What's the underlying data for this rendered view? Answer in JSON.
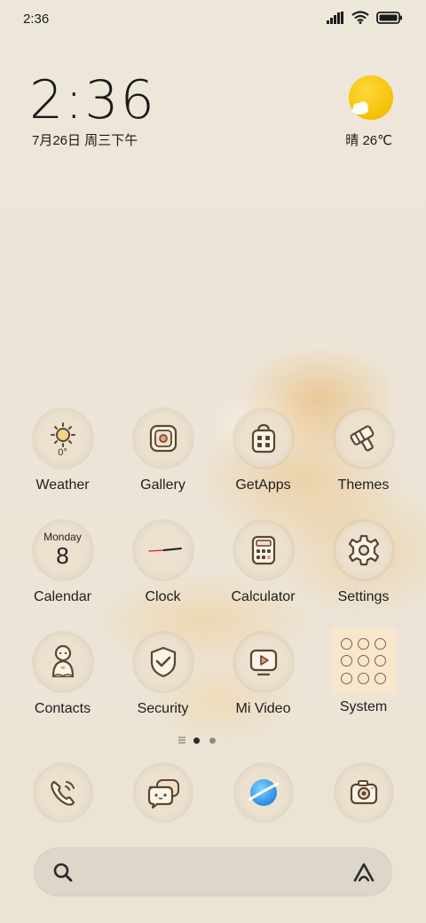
{
  "status_bar": {
    "time": "2:36"
  },
  "clock_widget": {
    "time": "2:36",
    "date": "7月26日 周三下午"
  },
  "weather_widget": {
    "condition": "晴",
    "temperature": "26℃",
    "icon": "sun-cloud-icon"
  },
  "apps": [
    {
      "label": "Weather",
      "icon": "sun-icon",
      "badge": "0°"
    },
    {
      "label": "Gallery",
      "icon": "gallery-icon"
    },
    {
      "label": "GetApps",
      "icon": "shopping-bag-icon"
    },
    {
      "label": "Themes",
      "icon": "paint-brush-icon"
    },
    {
      "label": "Calendar",
      "icon": "calendar-icon",
      "weekday": "Monday",
      "day": "8"
    },
    {
      "label": "Clock",
      "icon": "clock-icon"
    },
    {
      "label": "Calculator",
      "icon": "calculator-icon"
    },
    {
      "label": "Settings",
      "icon": "gear-icon"
    },
    {
      "label": "Contacts",
      "icon": "contact-person-icon"
    },
    {
      "label": "Security",
      "icon": "shield-check-icon"
    },
    {
      "label": "Mi Video",
      "icon": "video-play-icon"
    },
    {
      "label": "System",
      "icon": "folder-grid-icon"
    }
  ],
  "page_indicator": {
    "pages": 2,
    "current": 1
  },
  "dock": [
    {
      "name": "phone",
      "icon": "phone-icon"
    },
    {
      "name": "messages",
      "icon": "message-bubble-icon"
    },
    {
      "name": "browser",
      "icon": "browser-planet-icon"
    },
    {
      "name": "camera",
      "icon": "camera-icon"
    }
  ],
  "search_bar": {
    "left_icon": "search-icon",
    "right_icon": "assistant-icon"
  }
}
